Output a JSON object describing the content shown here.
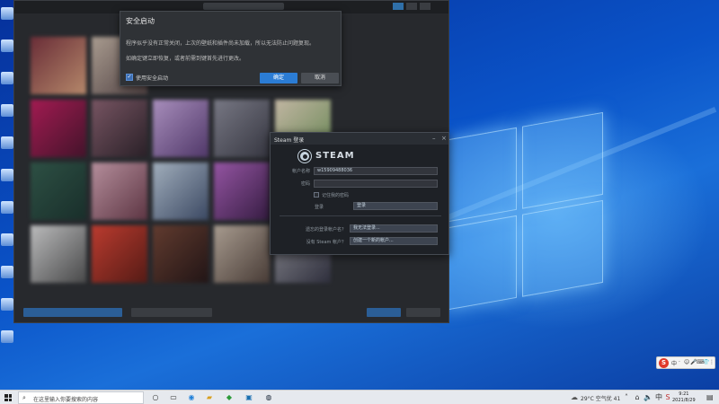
{
  "safe_start_dialog": {
    "title": "安全启动",
    "message_line1": "程序似乎没有正常关闭，上次的壁纸和插件尚未加载，所以无法防止问题复现。",
    "message_line2": "如确定键立即恢复，或者前需到键首先进行更改。",
    "checkbox_label": "使用安全启动",
    "checkbox_checked": true,
    "confirm_label": "确定",
    "cancel_label": "取消"
  },
  "steam_login": {
    "window_title": "Steam 登录",
    "brand": "STEAM",
    "account_label": "帐户名称",
    "account_value": "w15909488036",
    "password_label": "密码",
    "password_value": "",
    "remember_label": "记住我的密码",
    "remember_checked": false,
    "login_label": "登录",
    "login_button": "登录",
    "forgot_question": "遗忘的登录帐户名？",
    "forgot_button": "我无法登录...",
    "no_account_question": "没有 Steam 帐户？",
    "create_button": "创建一个新的帐户..."
  },
  "taskbar": {
    "search_placeholder": "在这里输入你要搜索的内容",
    "weather": "29°C 空气优 41",
    "time": "9:21",
    "date": "2021/8/29",
    "ime_brand": "S",
    "ime_items": [
      "中",
      "·",
      "☺",
      "🎤",
      "⌨",
      "👕",
      "⋮⋮"
    ]
  },
  "colors": {
    "accent": "#2b7cd4",
    "steam_bg": "#1e2126",
    "dialog_bg": "#2f3236"
  }
}
